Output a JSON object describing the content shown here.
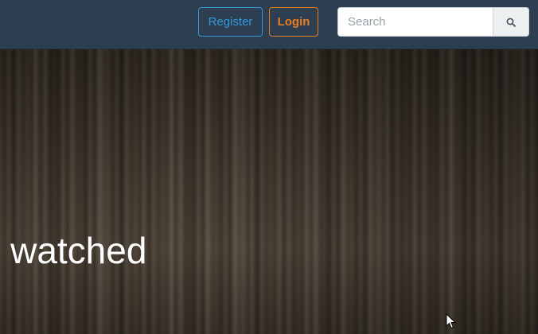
{
  "navbar": {
    "register_label": "Register",
    "login_label": "Login",
    "search": {
      "placeholder": "Search",
      "value": "",
      "icon": "search-icon"
    }
  },
  "hero": {
    "line1": "rk watched",
    "line2": "!"
  },
  "colors": {
    "navbar_bg": "#2c3e50",
    "register_accent": "#3498db",
    "login_accent": "#e67e22"
  }
}
